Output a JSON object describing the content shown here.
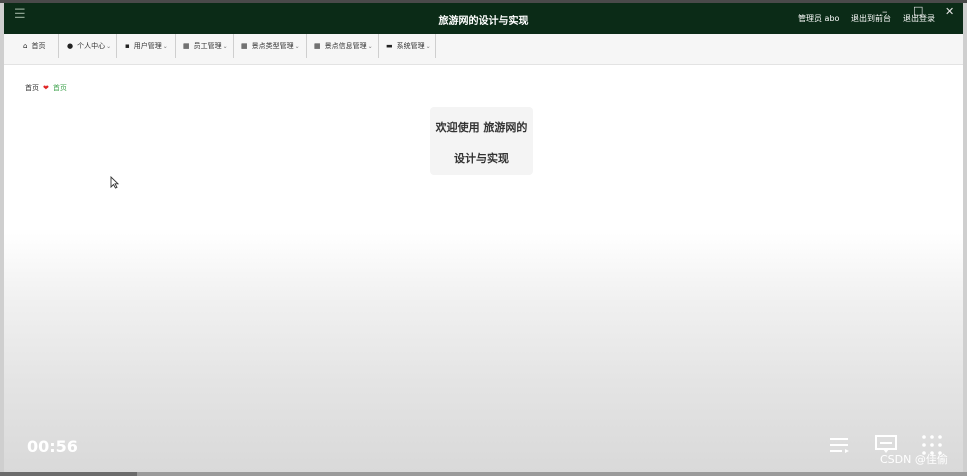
{
  "app": {
    "title": "旅游网的设计与实现",
    "admin_label": "管理员 abo",
    "exit_frontend": "退出到前台",
    "logout": "退出登录"
  },
  "nav": {
    "items": [
      {
        "label": "首页",
        "icon": "home-icon",
        "chevron": false
      },
      {
        "label": "个人中心",
        "icon": "user-icon",
        "chevron": true
      },
      {
        "label": "用户管理",
        "icon": "clipboard-icon",
        "chevron": true
      },
      {
        "label": "员工管理",
        "icon": "grid-icon",
        "chevron": true
      },
      {
        "label": "景点类型管理",
        "icon": "grid-icon",
        "chevron": true
      },
      {
        "label": "景点信息管理",
        "icon": "grid-icon",
        "chevron": true
      },
      {
        "label": "系统管理",
        "icon": "briefcase-icon",
        "chevron": true
      }
    ]
  },
  "breadcrumb": {
    "home": "首页",
    "current": "首页"
  },
  "welcome": {
    "line1": "欢迎使用 旅游网的",
    "line2": "设计与实现"
  },
  "video": {
    "time": "00:56",
    "watermark": "CSDN @佳偷"
  },
  "colors": {
    "header_bg": "#0b2b17",
    "nav_bg": "#f6f6f6",
    "breadcrumb_current": "#3fa34d",
    "heart": "#e02424"
  }
}
